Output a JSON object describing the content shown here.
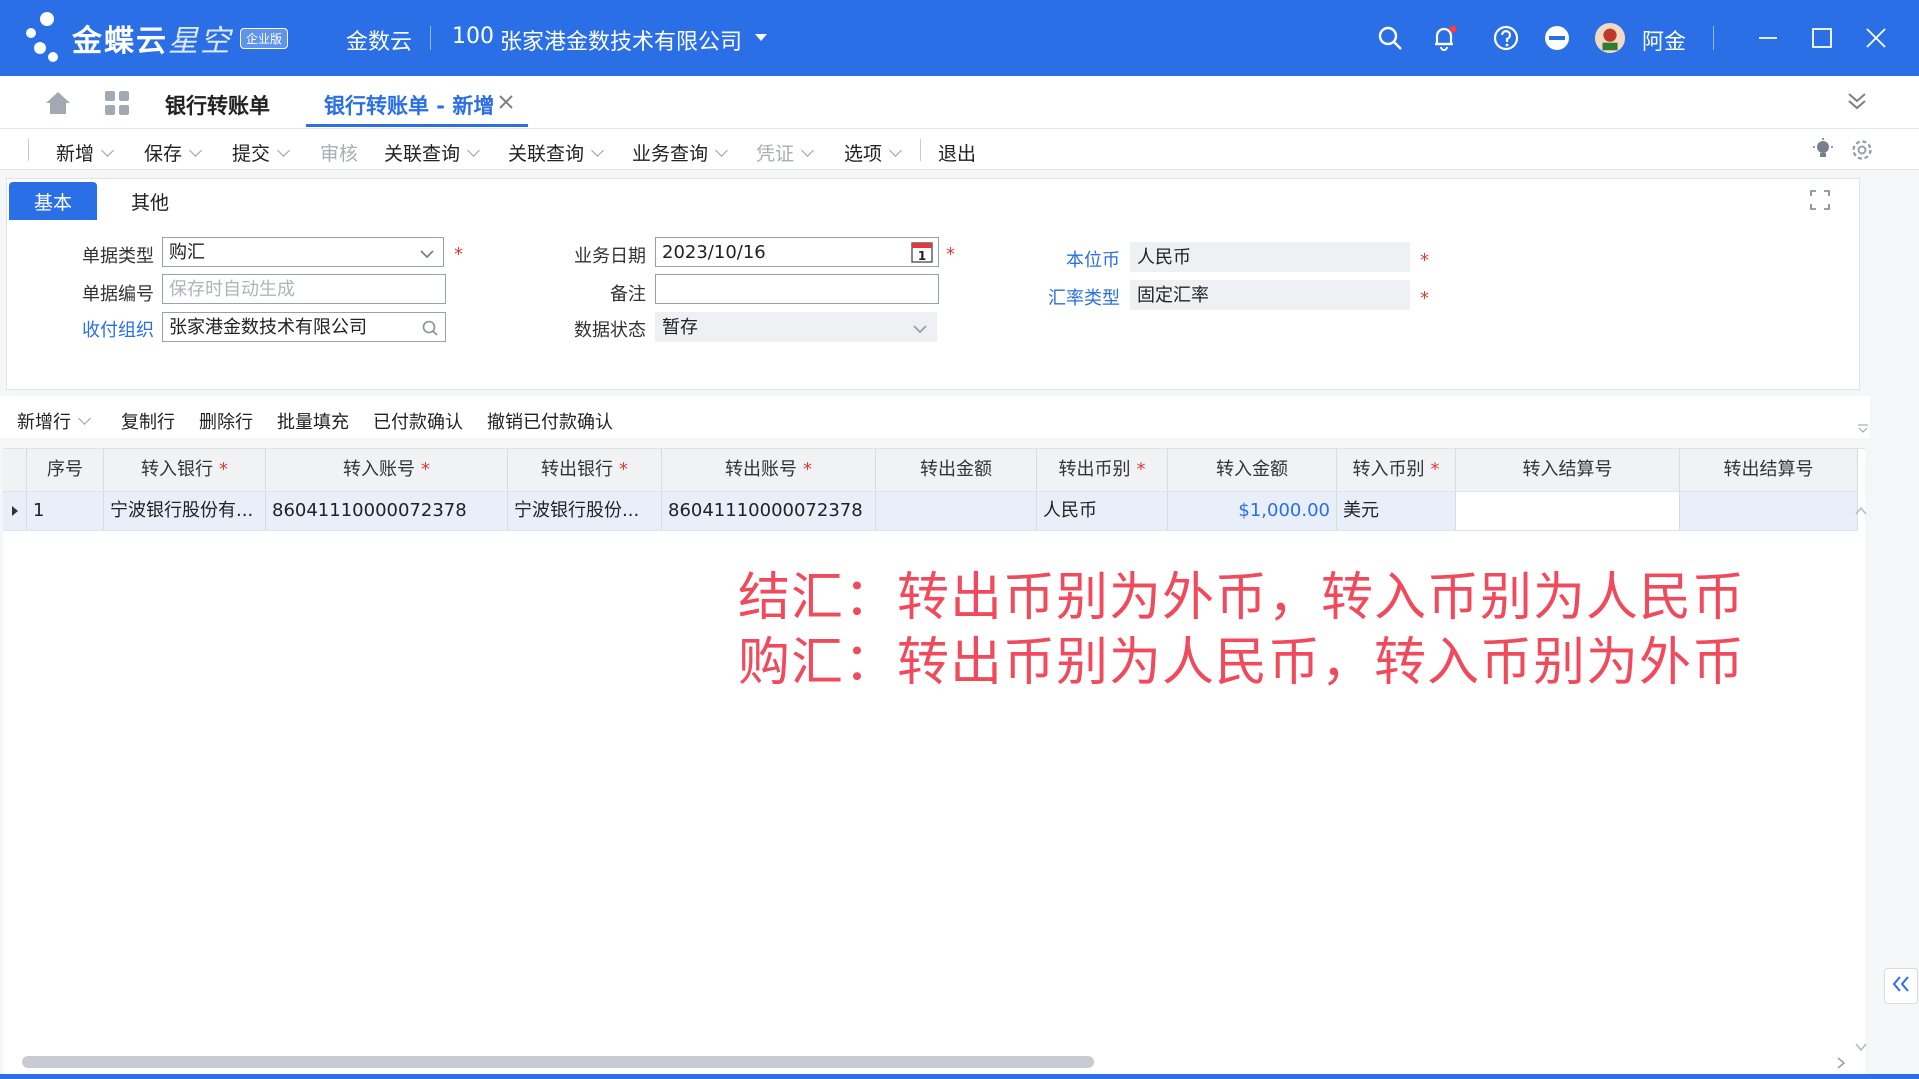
{
  "app": {
    "logo_text": "金蝶云",
    "logo_sub": "星空",
    "edition": "企业版",
    "product": "金数云",
    "org_code": "100",
    "org_name": "张家港金数技术有限公司",
    "user": "阿金"
  },
  "tabs": {
    "list_tab": "银行转账单",
    "active_tab": "银行转账单 - 新增"
  },
  "toolbar": [
    {
      "label": "新增",
      "dropdown": true,
      "disabled": false
    },
    {
      "label": "保存",
      "dropdown": true,
      "disabled": false
    },
    {
      "label": "提交",
      "dropdown": true,
      "disabled": false
    },
    {
      "label": "审核",
      "dropdown": false,
      "disabled": true
    },
    {
      "label": "关联查询",
      "dropdown": true,
      "disabled": false
    },
    {
      "label": "关联查询",
      "dropdown": true,
      "disabled": false
    },
    {
      "label": "业务查询",
      "dropdown": true,
      "disabled": false
    },
    {
      "label": "凭证",
      "dropdown": true,
      "disabled": true
    },
    {
      "label": "选项",
      "dropdown": true,
      "disabled": false
    },
    {
      "label": "退出",
      "dropdown": false,
      "disabled": false
    }
  ],
  "panel_tabs": {
    "basic": "基本",
    "other": "其他"
  },
  "form": {
    "doc_type_label": "单据类型",
    "doc_type_value": "购汇",
    "doc_no_label": "单据编号",
    "doc_no_placeholder": "保存时自动生成",
    "org_label": "收付组织",
    "org_value": "张家港金数技术有限公司",
    "date_label": "业务日期",
    "date_value": "2023/10/16",
    "remark_label": "备注",
    "remark_value": "",
    "status_label": "数据状态",
    "status_value": "暂存",
    "currency_label": "本位币",
    "currency_value": "人民币",
    "rate_type_label": "汇率类型",
    "rate_type_value": "固定汇率",
    "required_mark": "*",
    "calendar_day": "1"
  },
  "grid_toolbar": [
    "新增行",
    "复制行",
    "删除行",
    "批量填充",
    "已付款确认",
    "撤销已付款确认"
  ],
  "grid": {
    "columns": [
      "序号",
      "转入银行",
      "转入账号",
      "转出银行",
      "转出账号",
      "转出金额",
      "转出币别",
      "转入金额",
      "转入币别",
      "转入结算号",
      "转出结算号"
    ],
    "required": [
      false,
      true,
      true,
      true,
      true,
      false,
      true,
      false,
      true,
      false,
      false
    ],
    "rows": [
      [
        "1",
        "宁波银行股份有...",
        "860411100000723​78",
        "宁波银行股份...",
        "860411100000723​78",
        "",
        "人民币",
        "$1,000.00",
        "美元",
        "",
        ""
      ]
    ]
  },
  "annotation": {
    "line1": "结汇：转出币别为外币，转入币别为人民币",
    "line2": "购汇：转出币别为人民币，转入币别为外币"
  },
  "colors": {
    "brand": "#2a6fe6",
    "required": "#e03a3a",
    "annotation": "#ef4b5c"
  }
}
